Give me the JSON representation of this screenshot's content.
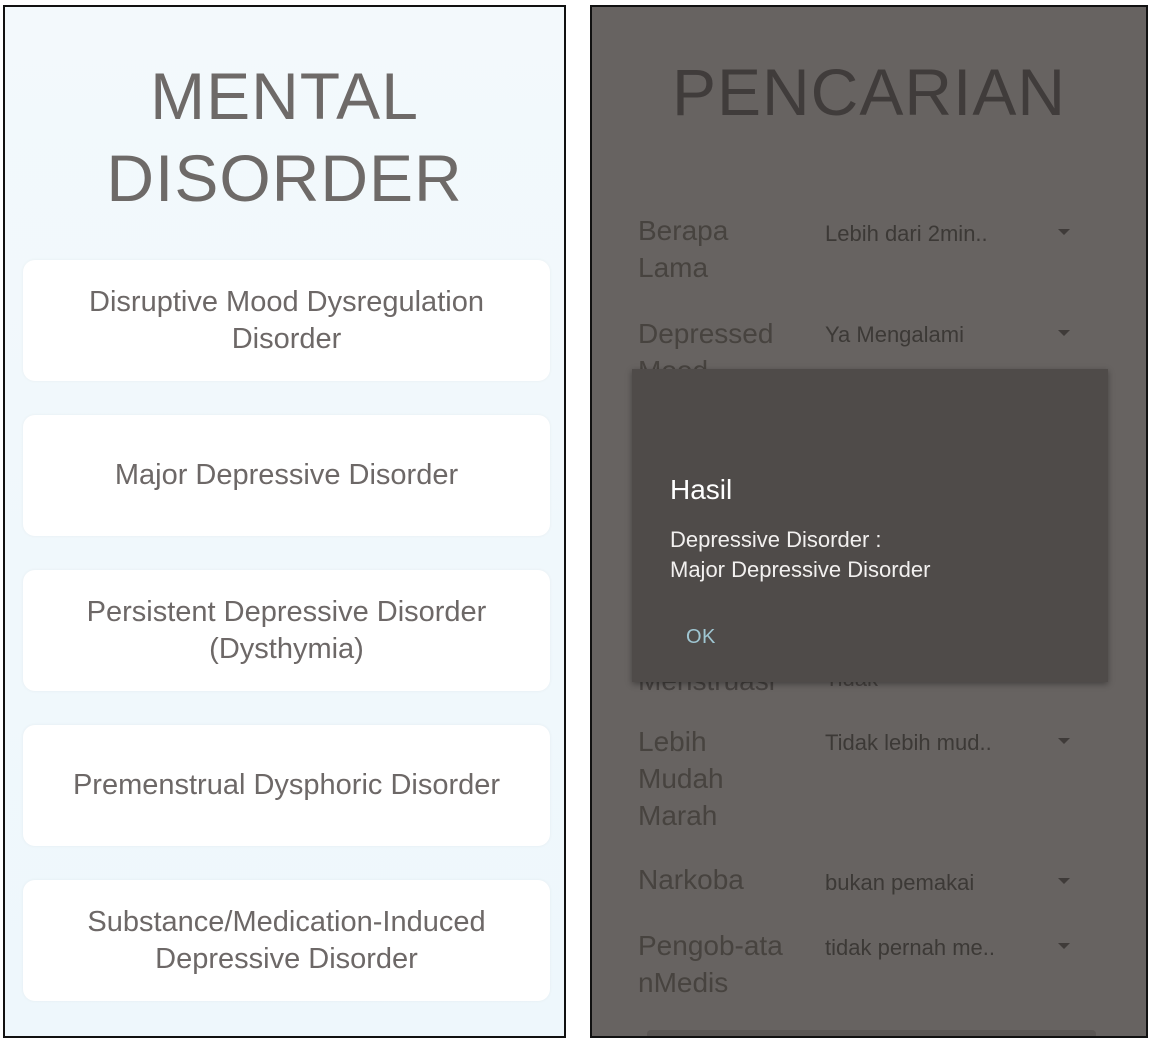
{
  "left_screen": {
    "title_line1": "MENTAL",
    "title_line2": "DISORDER",
    "items": [
      {
        "label": "Disruptive Mood Dysregulation Disorder"
      },
      {
        "label": "Major Depressive Disorder"
      },
      {
        "label": "Persistent Depressive Disorder (Dysthymia)"
      },
      {
        "label": "Premenstrual Dysphoric Disorder"
      },
      {
        "label": "Substance/Medication-Induced Depressive Disorder"
      }
    ]
  },
  "right_screen": {
    "title": "PENCARIAN",
    "fields": [
      {
        "label": "Berapa Lama",
        "value": "Lebih dari 2min.."
      },
      {
        "label": "Depressed Mood",
        "value": "Ya Mengalami"
      },
      {
        "label": "Menstruasi",
        "value": "Tidak"
      },
      {
        "label": "Lebih Mudah Marah",
        "value": "Tidak lebih mud.."
      },
      {
        "label": "Narkoba",
        "value": "bukan pemakai"
      },
      {
        "label": "Pengob-atanMedis",
        "value": "tidak pernah me.."
      }
    ],
    "dialog": {
      "title": "Hasil",
      "message": "Depressive Disorder :\nMajor Depressive Disorder",
      "ok_label": "OK"
    }
  },
  "icons": {
    "dropdown": "caret-down-icon"
  }
}
